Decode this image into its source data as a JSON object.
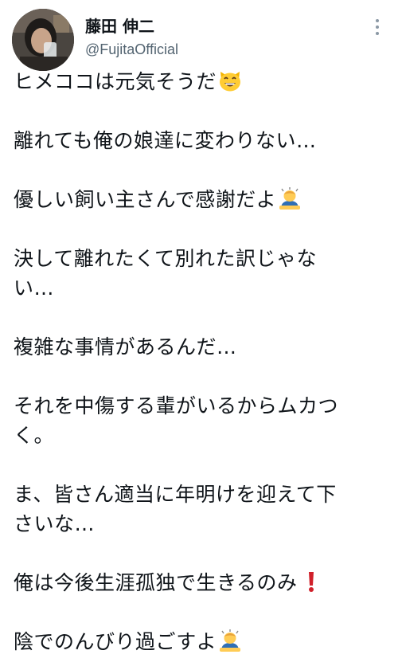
{
  "author": {
    "display_name": "藤田 伸二",
    "handle": "@FujitaOfficial"
  },
  "tweet": {
    "line1": "ヒメココは元気そうだ",
    "line2": "離れても俺の娘達に変わりない…",
    "line3": "優しい飼い主さんで感謝だよ",
    "line4a": "決して離れたくて別れた訳じゃな",
    "line4b": "い…",
    "line5": "複雑な事情があるんだ…",
    "line6a": "それを中傷する輩がいるからムカつ",
    "line6b": "く。",
    "line7a": "ま、皆さん適当に年明けを迎えて下",
    "line7b": "さいな…",
    "line8": "俺は今後生涯孤独で生きるのみ",
    "line9": "陰でのんびり過ごすよ"
  },
  "icons": {
    "emoji_1": "grinning-cat-icon",
    "emoji_2": "man-bowing-icon",
    "emoji_3": "exclamation-mark-icon",
    "emoji_4": "man-bowing-icon",
    "more": "more-options-icon"
  },
  "colors": {
    "text": "#0f1419",
    "secondary": "#536471",
    "exclamation": "#d0202a"
  }
}
